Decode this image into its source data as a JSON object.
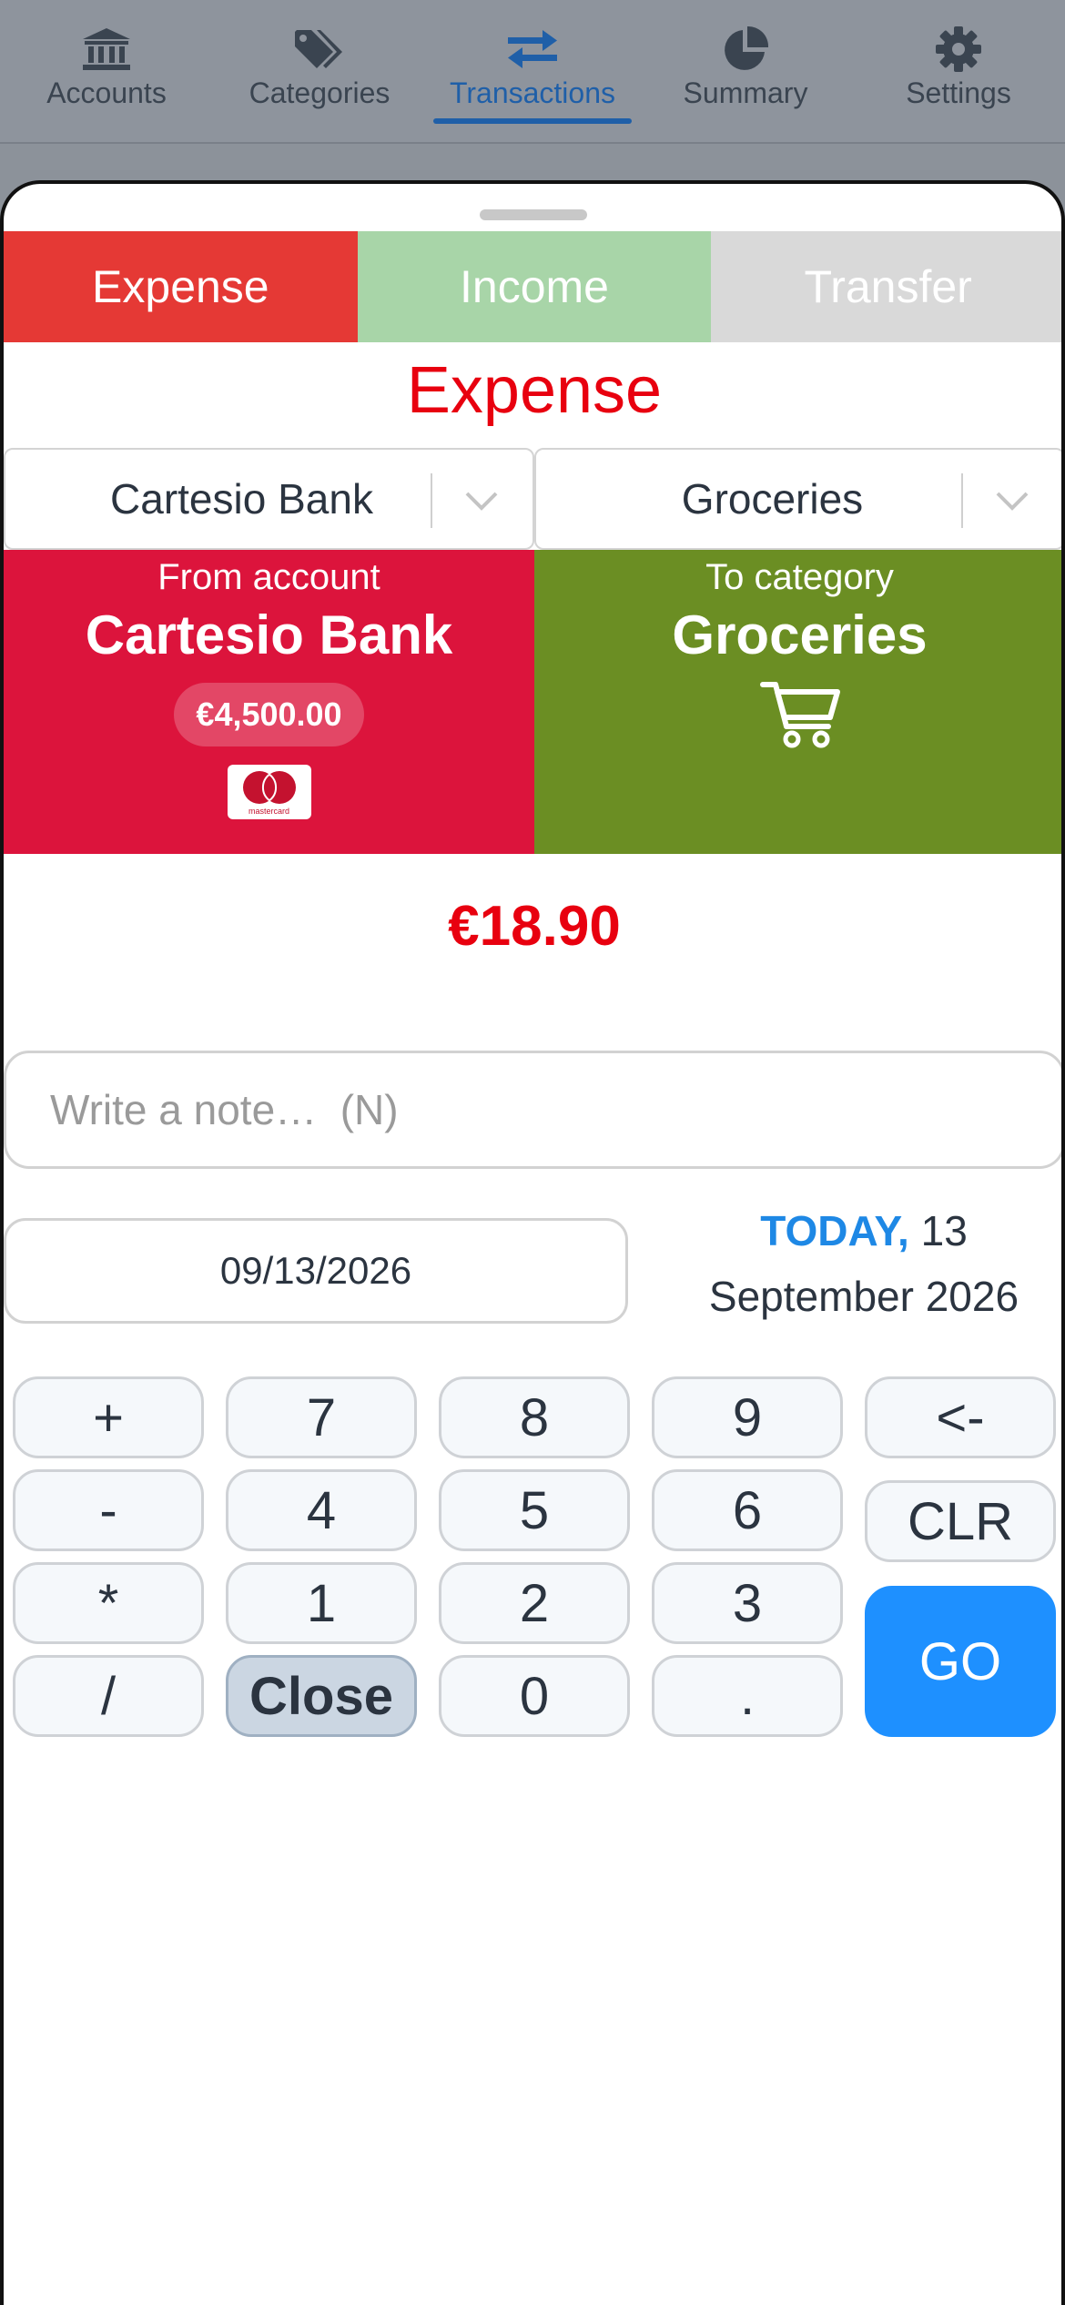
{
  "nav": {
    "items": [
      {
        "label": "Accounts",
        "icon": "bank-icon"
      },
      {
        "label": "Categories",
        "icon": "tags-icon"
      },
      {
        "label": "Transactions",
        "icon": "transfer-arrows-icon"
      },
      {
        "label": "Summary",
        "icon": "pie-chart-icon"
      },
      {
        "label": "Settings",
        "icon": "gear-icon"
      }
    ],
    "active": "Transactions"
  },
  "tabs": {
    "expense": "Expense",
    "income": "Income",
    "transfer": "Transfer"
  },
  "type_title": "Expense",
  "selects": {
    "account": "Cartesio Bank",
    "category": "Groceries"
  },
  "from_card": {
    "subtitle": "From account",
    "name": "Cartesio Bank",
    "balance": "€4,500.00",
    "logo_text": "mastercard"
  },
  "to_card": {
    "subtitle": "To category",
    "name": "Groceries",
    "icon": "shopping-cart-icon"
  },
  "amount": "€18.90",
  "note": {
    "placeholder": "Write a note…  (N)",
    "value": ""
  },
  "date": {
    "value": "09/13/2026",
    "today_label": "TODAY,",
    "day": "13",
    "month_year": "September 2026"
  },
  "keypad": {
    "keys": [
      "+",
      "7",
      "8",
      "9",
      "<-",
      "-",
      "4",
      "5",
      "6",
      "CLR",
      "*",
      "1",
      "2",
      "3",
      "/",
      "Close",
      "0",
      ".",
      "GO"
    ]
  },
  "colors": {
    "expense": "#e53935",
    "income": "#a8d5a8",
    "transfer": "#d9d9d9",
    "from_card": "#dc143c",
    "to_card": "#6b8e23",
    "accent": "#1e90ff",
    "amount": "#e8000f"
  }
}
